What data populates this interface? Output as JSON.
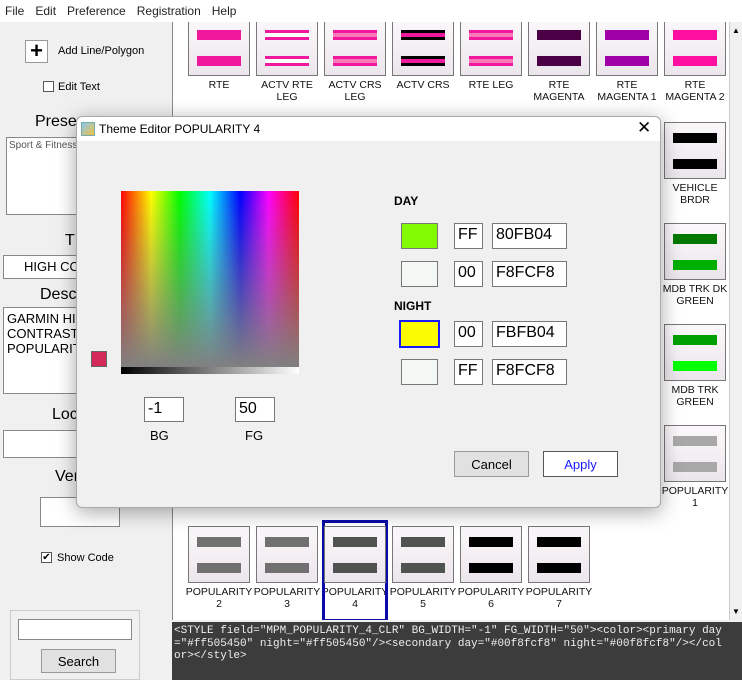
{
  "menu": [
    "File",
    "Edit",
    "Preference",
    "Registration",
    "Help"
  ],
  "left": {
    "add_label": "Add Line/Polygon",
    "edit_text_label": "Edit Text",
    "edit_text_checked": false,
    "preset_label": "Prese",
    "preset_list": [
      "Sport & Fitness"
    ],
    "type_label": "T",
    "type_value": "HIGH CO",
    "desc_label": "Descr",
    "desc_value": "GARMIN HI\nCONTRAST\nPOPULARIT",
    "loc_label": "Loc",
    "ver_label": "Ver",
    "show_code_label": "Show Code",
    "show_code_checked": true,
    "search_value": "",
    "search_button": "Search"
  },
  "tiles": [
    {
      "name": "RTE",
      "bars": [
        {
          "outer": "#f0189c",
          "inner": "#f0189c"
        },
        {
          "outer": "#f0189c",
          "inner": "#f0189c"
        }
      ]
    },
    {
      "name": "ACTV RTE LEG",
      "bars": [
        {
          "outer": "#f0189c",
          "inner": "#ffffff"
        },
        {
          "outer": "#f0189c",
          "inner": "#ffffff"
        }
      ]
    },
    {
      "name": "ACTV CRS LEG",
      "bars": [
        {
          "outer": "#f0189c",
          "inner": "#f878b8"
        },
        {
          "outer": "#f0189c",
          "inner": "#f878b8"
        }
      ]
    },
    {
      "name": "ACTV CRS",
      "bars": [
        {
          "outer": "#000000",
          "inner": "#f0189c"
        },
        {
          "outer": "#000000",
          "inner": "#f0189c"
        }
      ]
    },
    {
      "name": "RTE LEG",
      "bars": [
        {
          "outer": "#f0189c",
          "inner": "#f878b8"
        },
        {
          "outer": "#f0189c",
          "inner": "#f878b8"
        }
      ]
    },
    {
      "name": "RTE MAGENTA",
      "bars": [
        {
          "outer": "#4b0046",
          "inner": "#4b0046"
        },
        {
          "outer": "#4b0046",
          "inner": "#4b0046"
        }
      ]
    },
    {
      "name": "RTE MAGENTA 1",
      "bars": [
        {
          "outer": "#a000a8",
          "inner": "#a000a8"
        },
        {
          "outer": "#a000a8",
          "inner": "#a000a8"
        }
      ]
    },
    {
      "name": "RTE MAGENTA 2",
      "bars": [
        {
          "outer": "#ff10a0",
          "inner": "#ff10a0"
        },
        {
          "outer": "#ff10a0",
          "inner": "#ff10a0"
        }
      ]
    },
    {
      "name": "VEHICLE BRDR",
      "bars": [
        {
          "outer": "#000000",
          "inner": "#000000"
        },
        {
          "outer": "#000000",
          "inner": "#000000"
        }
      ]
    },
    {
      "name": "MDB TRK DK GREEN",
      "bars": [
        {
          "outer": "#007800",
          "inner": "#007800"
        },
        {
          "outer": "#00b000",
          "inner": "#00b000"
        }
      ]
    },
    {
      "name": "MDB TRK GREEN",
      "bars": [
        {
          "outer": "#00a000",
          "inner": "#00a000"
        },
        {
          "outer": "#00ff00",
          "inner": "#00ff00"
        }
      ]
    },
    {
      "name": "POPULARITY 1",
      "bars": [
        {
          "outer": "#a8a8a8",
          "inner": "#a8a8a8"
        },
        {
          "outer": "#a8a8a8",
          "inner": "#a8a8a8"
        }
      ]
    },
    {
      "name": "POPULARITY 2",
      "bars": [
        {
          "outer": "#707070",
          "inner": "#707070"
        },
        {
          "outer": "#707070",
          "inner": "#707070"
        }
      ]
    },
    {
      "name": "POPULARITY 3",
      "bars": [
        {
          "outer": "#707070",
          "inner": "#707070"
        },
        {
          "outer": "#707070",
          "inner": "#707070"
        }
      ]
    },
    {
      "name": "POPULARITY 4",
      "selected": true,
      "bars": [
        {
          "outer": "#505450",
          "inner": "#505450"
        },
        {
          "outer": "#505450",
          "inner": "#505450"
        }
      ]
    },
    {
      "name": "POPULARITY 5",
      "bars": [
        {
          "outer": "#505450",
          "inner": "#505450"
        },
        {
          "outer": "#505450",
          "inner": "#505450"
        }
      ]
    },
    {
      "name": "POPULARITY 6",
      "bars": [
        {
          "outer": "#000000",
          "inner": "#000000"
        },
        {
          "outer": "#000000",
          "inner": "#000000"
        }
      ]
    },
    {
      "name": "POPULARITY 7",
      "bars": [
        {
          "outer": "#000000",
          "inner": "#000000"
        },
        {
          "outer": "#000000",
          "inner": "#000000"
        }
      ]
    }
  ],
  "code": "<STYLE field=\"MPM_POPULARITY_4_CLR\" BG_WIDTH=\"-1\" FG_WIDTH=\"50\"><color><primary day=\"#ff505450\" night=\"#ff505450\"/><secondary day=\"#00f8fcf8\" night=\"#00f8fcf8\"/></color></style>",
  "dialog": {
    "title": "Theme Editor POPULARITY 4",
    "current_color": "#d42a5a",
    "bg_value": "-1",
    "bg_label": "BG",
    "fg_value": "50",
    "fg_label": "FG",
    "day_label": "DAY",
    "night_label": "NIGHT",
    "day": [
      {
        "swatch": "#80fb04",
        "alpha": "FF",
        "hex": "80FB04"
      },
      {
        "swatch": "#f4f8f4",
        "alpha": "00",
        "hex": "F8FCF8"
      }
    ],
    "night": [
      {
        "swatch": "#fbfb04",
        "alpha": "00",
        "hex": "FBFB04",
        "selected": true
      },
      {
        "swatch": "#f4f8f4",
        "alpha": "FF",
        "hex": "F8FCF8"
      }
    ],
    "cancel": "Cancel",
    "apply": "Apply"
  }
}
